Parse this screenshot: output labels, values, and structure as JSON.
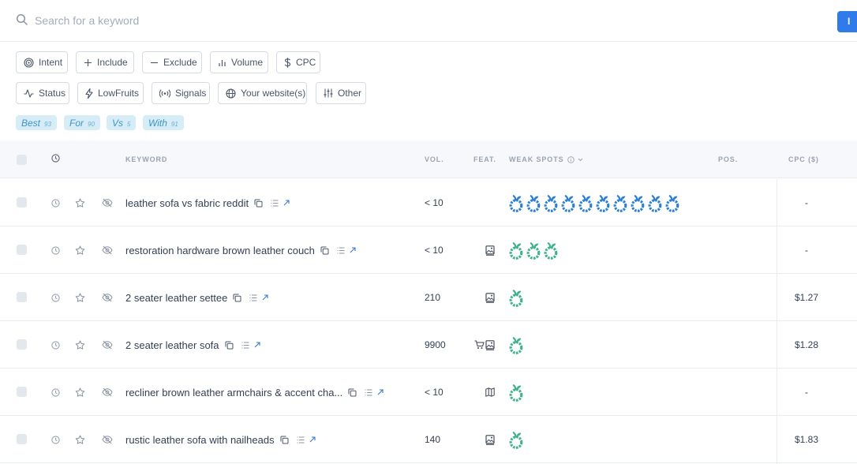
{
  "search": {
    "placeholder": "Search for a keyword",
    "button_label": "I"
  },
  "filters": {
    "row1": [
      {
        "label": "Intent",
        "icon": "target-icon"
      },
      {
        "label": "Include",
        "icon": "plus-icon"
      },
      {
        "label": "Exclude",
        "icon": "minus-icon"
      },
      {
        "label": "Volume",
        "icon": "bar-chart-icon"
      },
      {
        "label": "CPC",
        "icon": "dollar-icon"
      }
    ],
    "row2": [
      {
        "label": "Status",
        "icon": "pulse-icon"
      },
      {
        "label": "LowFruits",
        "icon": "bolt-icon"
      },
      {
        "label": "Signals",
        "icon": "broadcast-icon"
      },
      {
        "label": "Your website(s)",
        "icon": "globe-icon"
      },
      {
        "label": "Other",
        "icon": "sliders-icon"
      }
    ]
  },
  "tags": [
    {
      "label": "Best",
      "count": "93"
    },
    {
      "label": "For",
      "count": "90"
    },
    {
      "label": "Vs",
      "count": "5"
    },
    {
      "label": "With",
      "count": "91"
    }
  ],
  "table": {
    "headers": {
      "keyword": "KEYWORD",
      "vol": "VOL.",
      "feat": "FEAT.",
      "weak_spots": "WEAK SPOTS",
      "pos": "POS.",
      "cpc": "CPC ($)"
    },
    "rows": [
      {
        "keyword": "leather sofa vs fabric reddit",
        "vol": "< 10",
        "features": [],
        "weak_spots": 10,
        "weak_color": "blue",
        "cpc": "-"
      },
      {
        "keyword": "restoration hardware brown leather couch",
        "vol": "< 10",
        "features": [
          "image-icon"
        ],
        "weak_spots": 3,
        "weak_color": "green",
        "cpc": "-"
      },
      {
        "keyword": "2 seater leather settee",
        "vol": "210",
        "features": [
          "image-icon"
        ],
        "weak_spots": 1,
        "weak_color": "green",
        "cpc": "$1.27"
      },
      {
        "keyword": "2 seater leather sofa",
        "vol": "9900",
        "features": [
          "cart-icon",
          "image-icon"
        ],
        "weak_spots": 1,
        "weak_color": "green",
        "cpc": "$1.28"
      },
      {
        "keyword": "recliner brown leather armchairs & accent cha...",
        "vol": "< 10",
        "features": [
          "map-icon"
        ],
        "weak_spots": 1,
        "weak_color": "green",
        "cpc": "-"
      },
      {
        "keyword": "rustic leather sofa with nailheads",
        "vol": "140",
        "features": [
          "image-icon"
        ],
        "weak_spots": 1,
        "weak_color": "green",
        "cpc": "$1.83"
      }
    ]
  },
  "colors": {
    "accent": "#2f7bea",
    "weak_blue": "#2a7fd4",
    "weak_green": "#3fb28b",
    "tag_bg": "#d6ecf7"
  }
}
